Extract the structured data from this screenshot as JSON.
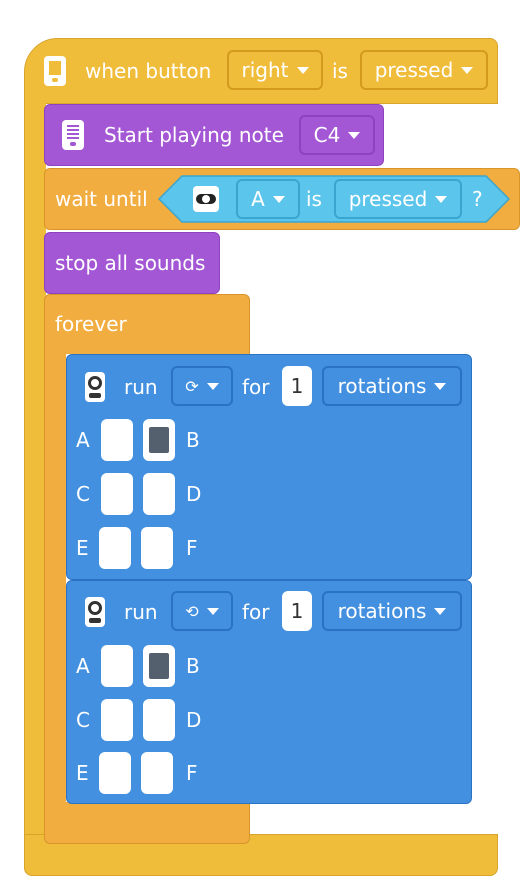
{
  "hat": {
    "when_label": "when button",
    "button_value": "right",
    "is_label": "is",
    "state_value": "pressed"
  },
  "note_block": {
    "label": "Start playing note",
    "note_value": "C4"
  },
  "wait_block": {
    "label": "wait until",
    "port_value": "A",
    "is_label": "is",
    "state_value": "pressed",
    "question_mark": "?"
  },
  "stop_block": {
    "label": "stop all sounds"
  },
  "forever_block": {
    "label": "forever"
  },
  "run_blocks": [
    {
      "run_label": "run",
      "direction_icon": "clockwise-icon",
      "direction_glyph": "⟳",
      "for_label": "for",
      "count": "1",
      "unit_value": "rotations",
      "ports": [
        "A",
        "B",
        "C",
        "D",
        "E",
        "F"
      ],
      "selected": [
        "B"
      ]
    },
    {
      "run_label": "run",
      "direction_icon": "counterclockwise-icon",
      "direction_glyph": "⟲",
      "for_label": "for",
      "count": "1",
      "unit_value": "rotations",
      "ports": [
        "A",
        "B",
        "C",
        "D",
        "E",
        "F"
      ],
      "selected": [
        "B"
      ]
    }
  ],
  "colors": {
    "events": "#f0bd3b",
    "control": "#f2ad40",
    "sound": "#a457d4",
    "motor": "#4390e0",
    "sensor": "#5cc5eb"
  }
}
